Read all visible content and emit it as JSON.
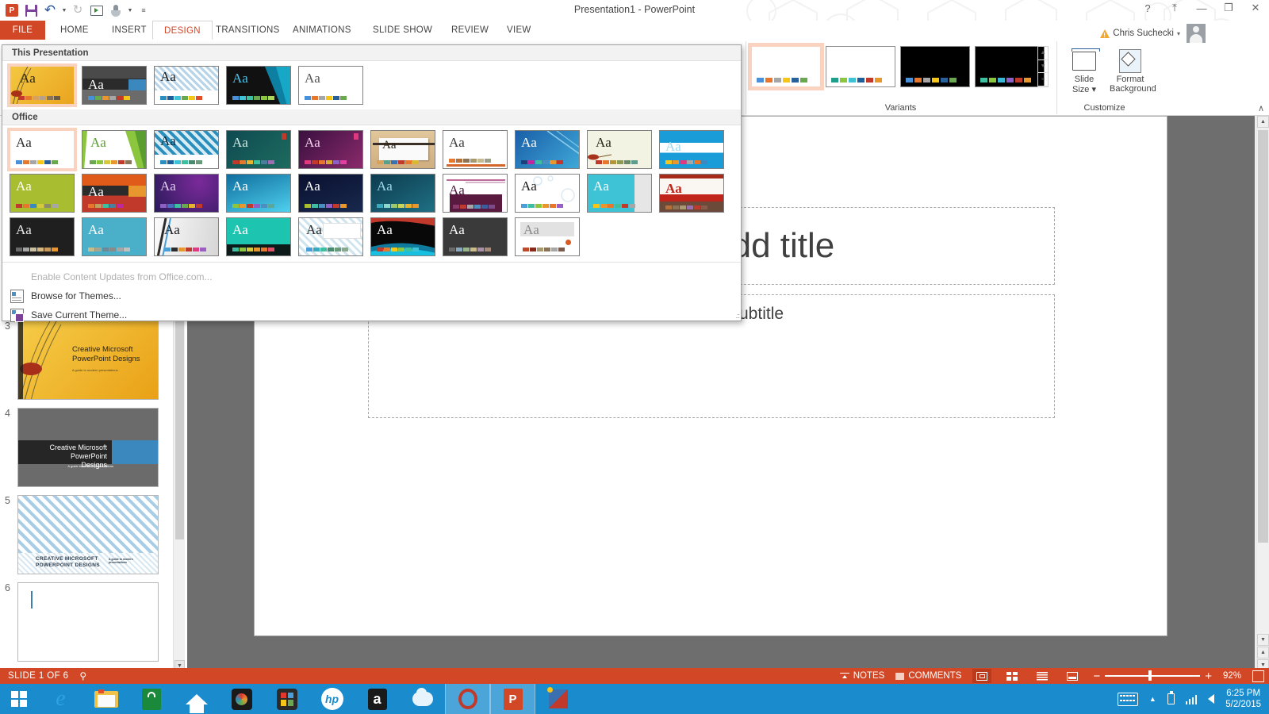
{
  "titlebar": {
    "document_title": "Presentation1 - PowerPoint",
    "quick_access": [
      {
        "name": "powerpoint-logo",
        "label": "P"
      },
      {
        "name": "save-icon",
        "label": "Save"
      },
      {
        "name": "undo-icon",
        "label": "Undo"
      },
      {
        "name": "redo-icon",
        "label": "Repeat"
      },
      {
        "name": "start-slideshow-icon",
        "label": "Start From Beginning"
      },
      {
        "name": "touch-mode-icon",
        "label": "Touch/Mouse Mode"
      },
      {
        "name": "customize-qat-icon",
        "label": "Customize Quick Access Toolbar"
      }
    ],
    "help_label": "?",
    "ribbon_display_label": "⤒",
    "minimize_label": "—",
    "restore_label": "❐",
    "close_label": "✕",
    "account_name": "Chris Suchecki",
    "account_caret": "▾"
  },
  "tabs": [
    {
      "id": "file",
      "label": "FILE",
      "active": false
    },
    {
      "id": "home",
      "label": "HOME",
      "active": false
    },
    {
      "id": "insert",
      "label": "INSERT",
      "active": false
    },
    {
      "id": "design",
      "label": "DESIGN",
      "active": true
    },
    {
      "id": "transitions",
      "label": "TRANSITIONS",
      "active": false
    },
    {
      "id": "animations",
      "label": "ANIMATIONS",
      "active": false
    },
    {
      "id": "slideshow",
      "label": "SLIDE SHOW",
      "active": false
    },
    {
      "id": "review",
      "label": "REVIEW",
      "active": false
    },
    {
      "id": "view",
      "label": "VIEW",
      "active": false
    }
  ],
  "ribbon": {
    "variants": {
      "group_label": "Variants",
      "items": [
        {
          "bg": "#ffffff",
          "selected": true,
          "swatches": [
            "#4a90d9",
            "#e8772e",
            "#a6a6a6",
            "#f5c518",
            "#2a6099",
            "#6aa84f"
          ]
        },
        {
          "bg": "#ffffff",
          "selected": false,
          "swatches": [
            "#1f9e89",
            "#8cc63f",
            "#3ec3d6",
            "#1f5f99",
            "#c0392b",
            "#e8962e"
          ]
        },
        {
          "bg": "#000000",
          "selected": false,
          "swatches": [
            "#4a90d9",
            "#e8772e",
            "#a6a6a6",
            "#f5c518",
            "#2a6099",
            "#6aa84f"
          ]
        },
        {
          "bg": "#000000",
          "selected": false,
          "swatches": [
            "#3dbfa0",
            "#8cc63f",
            "#39b8d6",
            "#8e5fc4",
            "#c0392b",
            "#e8962e"
          ]
        }
      ],
      "scroll_up": "▲",
      "scroll_down": "▼",
      "scroll_more": "≡"
    },
    "customize": {
      "group_label": "Customize",
      "buttons": [
        {
          "name": "slide-size-button",
          "line1": "Slide",
          "line2": "Size ▾"
        },
        {
          "name": "format-background-button",
          "line1": "Format",
          "line2": "Background"
        }
      ]
    },
    "collapse_label": "∧"
  },
  "theme_gallery": {
    "section_this_presentation": "This Presentation",
    "section_office": "Office",
    "this_presentation": [
      {
        "name": "theme-facet-gold",
        "bg": "linear-gradient(135deg,#f4c842,#eaa41e)",
        "aa": "#3a2f10",
        "selected": true,
        "swatches": [
          "#c0392b",
          "#e8772e",
          "#d9a05b",
          "#b5a18b",
          "#8b7355",
          "#6b5b45"
        ]
      },
      {
        "name": "theme-dark-banded",
        "bg": "linear-gradient(180deg,#4a4a4a 0%,#4a4a4a 38%,#2b2b2b 38%,#2b2b2b 66%,#6b6b6b 66%)",
        "aa": "#ffffff",
        "selected": false,
        "swatches": [
          "#4a90d9",
          "#6aa84f",
          "#e8962e",
          "#a6a6a6",
          "#c0392b",
          "#f5c518"
        ]
      },
      {
        "name": "theme-damask-blue",
        "bg": "#ffffff",
        "aa": "#1a1a1a",
        "selected": false,
        "swatches": [
          "#2a8fbd",
          "#1f5f99",
          "#3ec3d6",
          "#6aa84f",
          "#f5c518",
          "#e04e2a"
        ]
      },
      {
        "name": "theme-ion-dark",
        "bg": "linear-gradient(110deg,#1a1a1a 55%,#0d6e8c 55%)",
        "aa": "#4fc3e8",
        "selected": false,
        "swatches": [
          "#4a90d9",
          "#3ec3d6",
          "#3dbfa0",
          "#6aa84f",
          "#8cc63f",
          "#a8d65a"
        ]
      },
      {
        "name": "theme-white-plain",
        "bg": "#ffffff",
        "aa": "#555555",
        "selected": false,
        "swatches": [
          "#4a90d9",
          "#e8772e",
          "#a6a6a6",
          "#f5c518",
          "#2a6099",
          "#6aa84f"
        ]
      }
    ],
    "office_row1": [
      {
        "name": "theme-office",
        "bg": "#ffffff",
        "aa": "#2a2a2a",
        "selected": true,
        "swatches": [
          "#4a90d9",
          "#e8772e",
          "#a6a6a6",
          "#f5c518",
          "#2a6099",
          "#6aa84f"
        ]
      },
      {
        "name": "theme-facet",
        "bg": "#ffffff",
        "aa": "#5a9e2f",
        "selected": false,
        "swatches": [
          "#6aa84f",
          "#8cc63f",
          "#d4c93a",
          "#e8962e",
          "#c0392b",
          "#8b7355"
        ]
      },
      {
        "name": "theme-integral",
        "bg": "#ffffff",
        "aa": "#1a1a1a",
        "selected": false,
        "swatches": [
          "#2a8fbd",
          "#1f5f99",
          "#3ec3d6",
          "#3dbfa0",
          "#4a8a6f",
          "#6a9a7a"
        ]
      },
      {
        "name": "theme-ion",
        "bg": "linear-gradient(135deg,#0f4a52,#1d6b5e)",
        "aa": "#cfe9e4",
        "selected": false,
        "swatches": [
          "#c0392b",
          "#e8772e",
          "#e8b42e",
          "#3dbfa0",
          "#4a7f9e",
          "#9b6fb0"
        ]
      },
      {
        "name": "theme-ion-boardroom",
        "bg": "linear-gradient(135deg,#3a1040,#8a2a6b)",
        "aa": "#f0d0ea",
        "selected": false,
        "swatches": [
          "#e0397f",
          "#c0392b",
          "#e8772e",
          "#d9a832",
          "#8e5fc4",
          "#e040a0"
        ]
      },
      {
        "name": "theme-organic",
        "bg": "linear-gradient(180deg,#e8d5b0,#d4bb8e)",
        "aa": "#3a3020",
        "selected": false,
        "swatches": [
          "#d9a05b",
          "#5a9e8e",
          "#3a6fb0",
          "#c0392b",
          "#e8772e",
          "#d9b832"
        ]
      },
      {
        "name": "theme-retrospect",
        "bg": "#ffffff",
        "aa": "#3a3a3a",
        "selected": false,
        "swatches": [
          "#e8772e",
          "#b5703a",
          "#8b7355",
          "#a89a70",
          "#c5bb8e",
          "#9aa08a"
        ]
      },
      {
        "name": "theme-slice",
        "bg": "linear-gradient(135deg,#1a5fa8,#2f9fd4)",
        "aa": "#ffffff",
        "selected": false,
        "swatches": [
          "#1f3f7a",
          "#c0299b",
          "#3dbfa0",
          "#4a8fc0",
          "#e8962e",
          "#c0392b"
        ]
      },
      {
        "name": "theme-wisp",
        "bg": "#f4f4e4",
        "aa": "#3a3a2a",
        "selected": false,
        "swatches": [
          "#c0392b",
          "#e8772e",
          "#b5953a",
          "#8b9a55",
          "#6a8a6a",
          "#5a9e8e"
        ]
      },
      {
        "name": "theme-banded",
        "bg": "linear-gradient(180deg,#1a9cd8 0%,#1a9cd8 34%,#ffffff 34%,#ffffff 62%,#1a9cd8 62%)",
        "aa": "#bfe4f5",
        "selected": false,
        "swatches": [
          "#f5c518",
          "#e8962e",
          "#e0397f",
          "#a6a6a6",
          "#e8772e",
          "#3a8ac0"
        ]
      }
    ],
    "office_row2": [
      {
        "name": "theme-basis",
        "bg": "#a8bd2f",
        "aa": "#ffffff",
        "selected": false,
        "swatches": [
          "#c0392b",
          "#e8772e",
          "#3a8ac0",
          "#d4c93a",
          "#8b8b6a",
          "#a6a6a6"
        ]
      },
      {
        "name": "theme-berlin",
        "bg": "linear-gradient(180deg,#d94a1a 0%,#d94a1a 36%,#2b2b2b 36%,#2b2b2b 60%,#c0392b 60%)",
        "aa": "#ffffff",
        "selected": false,
        "swatches": [
          "#e8772e",
          "#c0a060",
          "#3dbfa0",
          "#4a7f9e",
          "#c0299b",
          "#c0392b"
        ]
      },
      {
        "name": "theme-celestial",
        "bg": "linear-gradient(135deg,#2a1a5a,#6a2a8a)",
        "aa": "#e0d0f0",
        "selected": false,
        "swatches": [
          "#8e5fc4",
          "#4a6fc0",
          "#3dbfa0",
          "#6aa84f",
          "#e8b42e",
          "#c0392b"
        ]
      },
      {
        "name": "theme-circuit",
        "bg": "linear-gradient(160deg,#0f6e9e,#3ec3e8)",
        "aa": "#ffffff",
        "selected": false,
        "swatches": [
          "#8cc63f",
          "#e8962e",
          "#c0392b",
          "#8e5fc4",
          "#4a8fc0",
          "#5aa89a"
        ]
      },
      {
        "name": "theme-damask",
        "bg": "linear-gradient(160deg,#0a1030,#1a2a50)",
        "aa": "#ffffff",
        "selected": false,
        "swatches": [
          "#a8bd2f",
          "#3dbfa0",
          "#4a8fc0",
          "#8e5fc4",
          "#c0392b",
          "#e8962e"
        ]
      },
      {
        "name": "theme-depth",
        "bg": "linear-gradient(160deg,#0d3a4e,#1a6a82)",
        "aa": "#9fd8ea",
        "selected": false,
        "swatches": [
          "#3aa8bd",
          "#8ed8d0",
          "#9ac86a",
          "#c8d45a",
          "#e8b42e",
          "#e8962e"
        ]
      },
      {
        "name": "theme-dividend",
        "bg": "#ffffff",
        "aa": "#4a1a3a",
        "selected": false,
        "swatches": [
          "#8a3a6a",
          "#c0392b",
          "#a6a6a6",
          "#4a8fc0",
          "#3a5f9e",
          "#7a4a8a"
        ]
      },
      {
        "name": "theme-droplet",
        "bg": "#ffffff",
        "aa": "#1a1a1a",
        "selected": false,
        "swatches": [
          "#4a9fd8",
          "#3dbfa0",
          "#8cc63f",
          "#e8962e",
          "#e8772e",
          "#9b5fc4"
        ]
      },
      {
        "name": "theme-facet-teal",
        "bg": "linear-gradient(90deg,#3ec3d6 0%,#3ec3d6 76%,#e0e0e0 76%)",
        "aa": "#ffffff",
        "selected": false,
        "swatches": [
          "#f5c518",
          "#e8962e",
          "#e8772e",
          "#3dbfa0",
          "#c0392b",
          "#a6a6a6"
        ]
      },
      {
        "name": "theme-frame",
        "bg": "#ffffff",
        "aa": "#c0392b",
        "selected": false,
        "swatches": [
          "#b5703a",
          "#8b7355",
          "#a89a70",
          "#9b6fb0",
          "#c0392b",
          "#8a5a4a"
        ]
      }
    ],
    "office_row3": [
      {
        "name": "theme-gallery",
        "bg": "#1f1f1f",
        "aa": "#e8e8e8",
        "selected": false,
        "swatches": [
          "#6a6a6a",
          "#a6a6a6",
          "#c8c0a0",
          "#d4b880",
          "#c89a5a",
          "#e8962e"
        ]
      },
      {
        "name": "theme-headlines",
        "bg": "#4aafc8",
        "aa": "#ffffff",
        "selected": false,
        "swatches": [
          "#c8bd8a",
          "#a6a690",
          "#6a8a9a",
          "#8a8a8a",
          "#a6a6a6",
          "#c0c0c0"
        ]
      },
      {
        "name": "theme-ion-light",
        "bg": "linear-gradient(100deg,#fafafa,#dadada)",
        "aa": "#1a1a1a",
        "selected": false,
        "swatches": [
          "#4a9fd8",
          "#2b2b2b",
          "#e8962e",
          "#c0392b",
          "#e0397f",
          "#9b5fc4"
        ]
      },
      {
        "name": "theme-mesh",
        "bg": "linear-gradient(180deg,#1dc4b0 0%,#1dc4b0 72%,#0d1a1a 72%)",
        "aa": "#ffffff",
        "selected": false,
        "swatches": [
          "#3dbfa0",
          "#8cc63f",
          "#d4c93a",
          "#e8962e",
          "#e8772e",
          "#e0506a"
        ]
      },
      {
        "name": "theme-metropolitan",
        "bg": "#ffffff",
        "aa": "#1a1a1a",
        "selected": false,
        "swatches": [
          "#4a9fd8",
          "#3aa8bd",
          "#3dbfa0",
          "#4a8a6f",
          "#6a9a7a",
          "#8aa890"
        ]
      },
      {
        "name": "theme-parallax",
        "bg": "linear-gradient(120deg,#0a0a0a,#0d4a5e)",
        "aa": "#ffffff",
        "selected": false,
        "swatches": [
          "#c0392b",
          "#e8772e",
          "#f5c518",
          "#8cc63f",
          "#3dbfa0",
          "#3ec3d6"
        ]
      },
      {
        "name": "theme-quotable",
        "bg": "#3a3a3a",
        "aa": "#ffffff",
        "selected": false,
        "swatches": [
          "#6a6a6a",
          "#8aa8c0",
          "#9ab58a",
          "#c8bd8a",
          "#a890a8",
          "#a88a7a"
        ]
      },
      {
        "name": "theme-savon",
        "bg": "#f0f0f0",
        "aa": "#8a8a8a",
        "selected": false,
        "swatches": [
          "#c0492b",
          "#8a2a1a",
          "#a89a70",
          "#8b7355",
          "#a6a6a6",
          "#7a5a4a"
        ]
      }
    ],
    "menu": [
      {
        "name": "enable-content-updates",
        "label": "Enable Content Updates from Office.com...",
        "disabled": true
      },
      {
        "name": "browse-for-themes",
        "label": "Browse for Themes...",
        "disabled": false
      },
      {
        "name": "save-current-theme",
        "label": "Save Current Theme...",
        "disabled": false
      }
    ]
  },
  "slides_pane": {
    "slides": [
      {
        "num": "3",
        "title_line1": "Creative Microsoft",
        "title_line2": "PowerPoint Designs",
        "subtitle": "A guide to modern presentations",
        "style": "gold"
      },
      {
        "num": "4",
        "title_line1": "Creative Microsoft",
        "title_line2": "PowerPoint Designs",
        "subtitle": "A guide to modern presentations",
        "style": "gray"
      },
      {
        "num": "5",
        "title_line1": "CREATIVE MICROSOFT",
        "title_line2": "POWERPOINT DESIGNS",
        "subtitle": "A guide to modern presentations",
        "style": "damask"
      },
      {
        "num": "6",
        "title_line1": "",
        "title_line2": "",
        "subtitle": "",
        "style": "blank"
      }
    ],
    "scroll_up": "▲",
    "scroll_down": "▼"
  },
  "slide_editor": {
    "title_placeholder": "Click to add title",
    "subtitle_placeholder": "Click to add subtitle",
    "scroll_up": "▲",
    "scroll_down": "▼",
    "scroll_prev": "▲",
    "scroll_next": "▼"
  },
  "statusbar": {
    "slide_counter": "SLIDE 1 OF 6",
    "language_icon": "proofing-icon",
    "notes_label": "NOTES",
    "comments_label": "COMMENTS",
    "views": [
      {
        "name": "view-normal",
        "active": true
      },
      {
        "name": "view-slide-sorter",
        "active": false
      },
      {
        "name": "view-reading",
        "active": false
      },
      {
        "name": "view-slideshow",
        "active": false
      }
    ],
    "zoom_out": "−",
    "zoom_in": "+",
    "zoom_level": "92%",
    "fit_label": "fit-to-window-icon"
  },
  "taskbar": {
    "start_label": "Start",
    "apps": [
      {
        "name": "internet-explorer-icon",
        "label": "e",
        "color": "#2a9fd8"
      },
      {
        "name": "file-explorer-icon",
        "label": "",
        "color": "#f5c518"
      },
      {
        "name": "store-icon",
        "label": "",
        "color": "#1a8a3a"
      },
      {
        "name": "home-icon",
        "label": "",
        "color": "#ffffff"
      },
      {
        "name": "camera-icon",
        "label": "",
        "color": "#1a1a1a"
      },
      {
        "name": "puzzle-icon",
        "label": "",
        "color": "#2a2a2a"
      },
      {
        "name": "hp-icon",
        "label": "hp",
        "color": "#ffffff"
      },
      {
        "name": "amazon-icon",
        "label": "a",
        "color": "#1a1a1a"
      },
      {
        "name": "cloud-icon",
        "label": "",
        "color": "#4a9fd8"
      },
      {
        "name": "opera-icon",
        "label": "O",
        "color": "#c0392b",
        "open": true
      },
      {
        "name": "powerpoint-taskbar-icon",
        "label": "P",
        "color": "#d24726",
        "open": true
      },
      {
        "name": "3d-builder-icon",
        "label": "",
        "color": "#3a6fb0",
        "open": false
      }
    ],
    "tray": {
      "keyboard_icon": "keyboard-icon",
      "show_hidden_icon": "▲",
      "battery_icon": "battery-icon",
      "network_icon": "signal-icon",
      "volume_icon": "speaker-icon",
      "time": "6:25 PM",
      "date": "5/2/2015"
    }
  }
}
